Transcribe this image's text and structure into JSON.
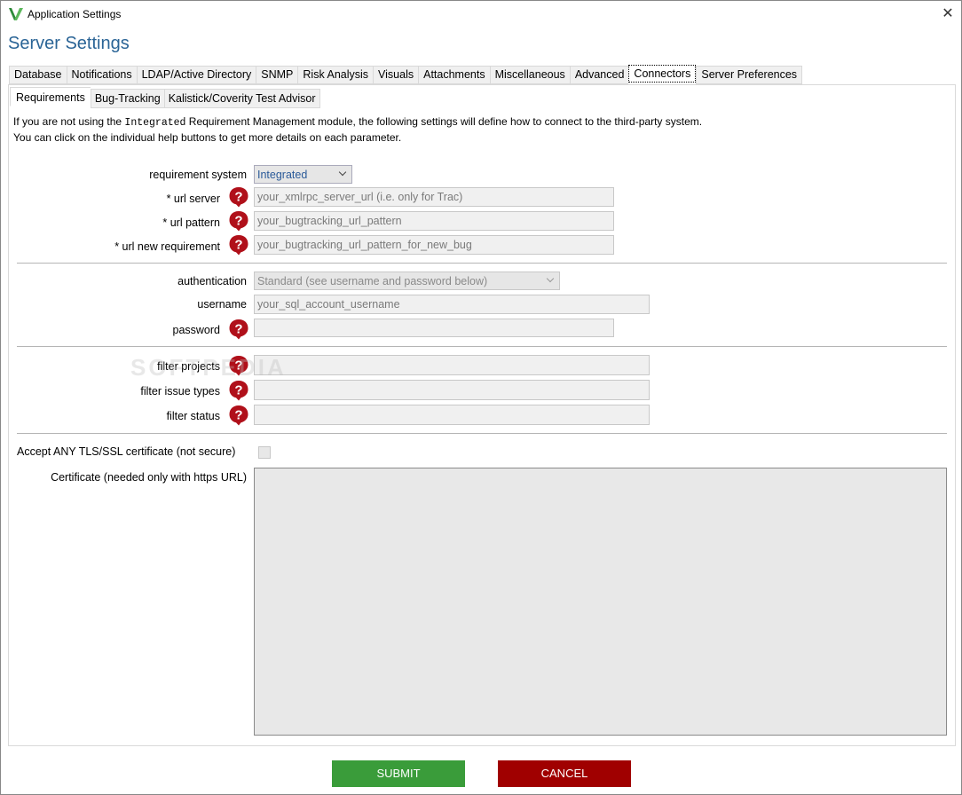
{
  "window": {
    "title": "Application Settings"
  },
  "page": {
    "title": "Server Settings"
  },
  "tabs": [
    {
      "label": "Database"
    },
    {
      "label": "Notifications"
    },
    {
      "label": "LDAP/Active Directory"
    },
    {
      "label": "SNMP"
    },
    {
      "label": "Risk Analysis"
    },
    {
      "label": "Visuals"
    },
    {
      "label": "Attachments"
    },
    {
      "label": "Miscellaneous"
    },
    {
      "label": "Advanced"
    },
    {
      "label": "Connectors",
      "active": true
    },
    {
      "label": "Server Preferences"
    }
  ],
  "subtabs": [
    {
      "label": "Requirements",
      "active": true
    },
    {
      "label": "Bug-Tracking"
    },
    {
      "label": "Kalistick/Coverity Test Advisor"
    }
  ],
  "intro": {
    "line1_pre": "If you are not using the ",
    "line1_code": "Integrated",
    "line1_post": " Requirement Management module, the following settings will define how to connect to the third-party system.",
    "line2": "You can click on the individual help buttons to get more details on each parameter."
  },
  "form": {
    "requirement_system": {
      "label": "requirement system",
      "value": "Integrated"
    },
    "url_server": {
      "label": "* url server",
      "placeholder": "your_xmlrpc_server_url (i.e. only for Trac)"
    },
    "url_pattern": {
      "label": "* url pattern",
      "placeholder": "your_bugtracking_url_pattern"
    },
    "url_new_requirement": {
      "label": "* url new requirement",
      "placeholder": "your_bugtracking_url_pattern_for_new_bug"
    },
    "authentication": {
      "label": "authentication",
      "value": "Standard (see username and password below)"
    },
    "username": {
      "label": "username",
      "placeholder": "your_sql_account_username"
    },
    "password": {
      "label": "password",
      "value": ""
    },
    "filter_projects": {
      "label": "filter projects",
      "value": ""
    },
    "filter_issue_types": {
      "label": "filter issue types",
      "value": ""
    },
    "filter_status": {
      "label": "filter status",
      "value": ""
    },
    "accept_tls": {
      "label": "Accept ANY TLS/SSL certificate (not secure)",
      "checked": false
    },
    "certificate": {
      "label": "Certificate (needed only with https URL)",
      "value": ""
    }
  },
  "watermark": "SOFTPEDIA",
  "buttons": {
    "submit": "SUBMIT",
    "cancel": "CANCEL"
  },
  "colors": {
    "title_blue": "#2a6496",
    "submit_green": "#3a9c3a",
    "cancel_red": "#a00000",
    "help_red": "#b0101a"
  },
  "icons": {
    "app": "app-logo-icon",
    "close": "close-icon",
    "help": "help-icon",
    "dropdown": "chevron-down-icon"
  }
}
